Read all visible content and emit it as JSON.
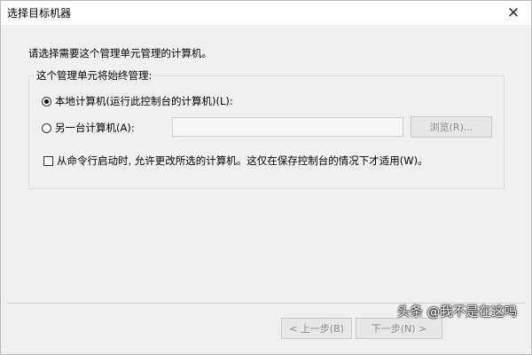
{
  "window": {
    "title": "选择目标机器",
    "close_glyph": "✕"
  },
  "dialog": {
    "prompt": "请选择需要这个管理单元管理的计算机。",
    "group_label": "这个管理单元将始终管理:",
    "local_option": {
      "label": "本地计算机(运行此控制台的计算机)(L):",
      "checked": true
    },
    "other_option": {
      "label": "另一台计算机(A):",
      "checked": false
    },
    "computer_name_value": "",
    "browse_label": "浏览(R)...",
    "allow_change": {
      "label": "从命令行启动时, 允许更改所选的计算机。这仅在保存控制台的情况下才适用(W)。",
      "checked": false
    }
  },
  "footer": {
    "back_label": "< 上一步(B)",
    "next_label": "下一步(N) >"
  },
  "watermark": "头条 @我不是在这吗"
}
